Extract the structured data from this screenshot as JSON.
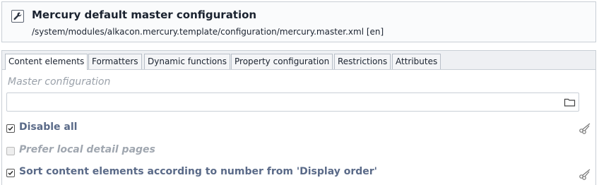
{
  "header": {
    "icon": "wrench-icon",
    "title": "Mercury default master configuration",
    "path": "/system/modules/alkacon.mercury.template/configuration/mercury.master.xml [en]"
  },
  "tabs": [
    {
      "label": "Content elements",
      "active": true
    },
    {
      "label": "Formatters",
      "active": false
    },
    {
      "label": "Dynamic functions",
      "active": false
    },
    {
      "label": "Property configuration",
      "active": false
    },
    {
      "label": "Restrictions",
      "active": false
    },
    {
      "label": "Attributes",
      "active": false
    }
  ],
  "master_field": {
    "label": "Master configuration",
    "value": "",
    "icon": "folder-icon"
  },
  "checkboxes": [
    {
      "label": "Disable all",
      "checked": true,
      "enabled": true,
      "icon": "scissors-icon"
    },
    {
      "label": "Prefer local detail pages",
      "checked": false,
      "enabled": false
    },
    {
      "label": "Sort content elements according to number from 'Display order'",
      "checked": true,
      "enabled": true,
      "icon": "scissors-icon"
    }
  ],
  "colors": {
    "label_text": "#5a6a88",
    "disabled_text": "#a0a7b0",
    "border": "#c9cfd6"
  }
}
